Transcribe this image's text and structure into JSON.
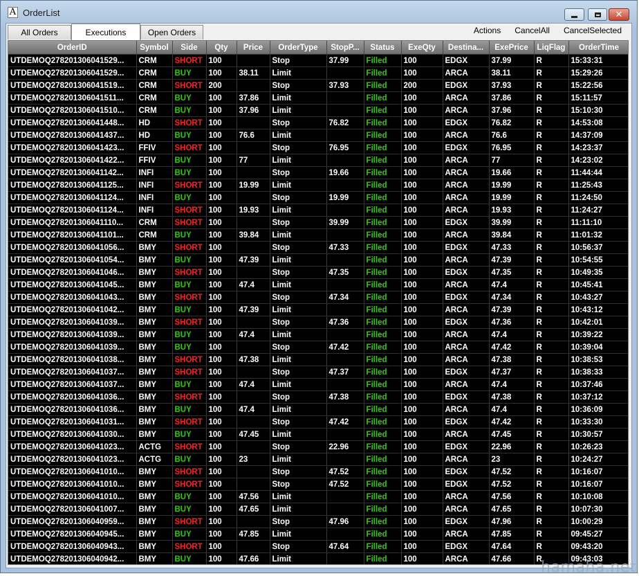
{
  "window": {
    "title": "OrderList"
  },
  "tabs": [
    "All Orders",
    "Executions",
    "Open Orders"
  ],
  "active_tab": "Executions",
  "menu": [
    "Actions",
    "CancelAll",
    "CancelSelected"
  ],
  "columns": [
    "OrderID",
    "Symbol",
    "Side",
    "Qty",
    "Price",
    "OrderType",
    "StopP...",
    "Status",
    "ExeQty",
    "Destina...",
    "ExePrice",
    "LiqFlag",
    "OrderTime"
  ],
  "rows": [
    [
      "UTDEMOQ278201306041529...",
      "CRM",
      "SHORT",
      "100",
      "",
      "Stop",
      "37.99",
      "Filled",
      "100",
      "EDGX",
      "37.99",
      "R",
      "15:33:31"
    ],
    [
      "UTDEMOQ278201306041529...",
      "CRM",
      "BUY",
      "100",
      "38.11",
      "Limit",
      "",
      "Filled",
      "100",
      "ARCA",
      "38.11",
      "R",
      "15:29:26"
    ],
    [
      "UTDEMOQ278201306041519...",
      "CRM",
      "SHORT",
      "200",
      "",
      "Stop",
      "37.93",
      "Filled",
      "200",
      "EDGX",
      "37.93",
      "R",
      "15:22:56"
    ],
    [
      "UTDEMOQ278201306041511...",
      "CRM",
      "BUY",
      "100",
      "37.86",
      "Limit",
      "",
      "Filled",
      "100",
      "ARCA",
      "37.86",
      "R",
      "15:11:57"
    ],
    [
      "UTDEMOQ278201306041510...",
      "CRM",
      "BUY",
      "100",
      "37.96",
      "Limit",
      "",
      "Filled",
      "100",
      "ARCA",
      "37.96",
      "R",
      "15:10:30"
    ],
    [
      "UTDEMOQ278201306041448...",
      "HD",
      "SHORT",
      "100",
      "",
      "Stop",
      "76.82",
      "Filled",
      "100",
      "EDGX",
      "76.82",
      "R",
      "14:53:08"
    ],
    [
      "UTDEMOQ278201306041437...",
      "HD",
      "BUY",
      "100",
      "76.6",
      "Limit",
      "",
      "Filled",
      "100",
      "ARCA",
      "76.6",
      "R",
      "14:37:09"
    ],
    [
      "UTDEMOQ278201306041423...",
      "FFIV",
      "SHORT",
      "100",
      "",
      "Stop",
      "76.95",
      "Filled",
      "100",
      "EDGX",
      "76.95",
      "R",
      "14:23:37"
    ],
    [
      "UTDEMOQ278201306041422...",
      "FFIV",
      "BUY",
      "100",
      "77",
      "Limit",
      "",
      "Filled",
      "100",
      "ARCA",
      "77",
      "R",
      "14:23:02"
    ],
    [
      "UTDEMOQ278201306041142...",
      "INFI",
      "BUY",
      "100",
      "",
      "Stop",
      "19.66",
      "Filled",
      "100",
      "ARCA",
      "19.66",
      "R",
      "11:44:44"
    ],
    [
      "UTDEMOQ278201306041125...",
      "INFI",
      "SHORT",
      "100",
      "19.99",
      "Limit",
      "",
      "Filled",
      "100",
      "ARCA",
      "19.99",
      "R",
      "11:25:43"
    ],
    [
      "UTDEMOQ278201306041124...",
      "INFI",
      "BUY",
      "100",
      "",
      "Stop",
      "19.99",
      "Filled",
      "100",
      "ARCA",
      "19.99",
      "R",
      "11:24:50"
    ],
    [
      "UTDEMOQ278201306041124...",
      "INFI",
      "SHORT",
      "100",
      "19.93",
      "Limit",
      "",
      "Filled",
      "100",
      "ARCA",
      "19.93",
      "R",
      "11:24:27"
    ],
    [
      "UTDEMOQ278201306041110...",
      "CRM",
      "SHORT",
      "100",
      "",
      "Stop",
      "39.99",
      "Filled",
      "100",
      "EDGX",
      "39.99",
      "R",
      "11:11:10"
    ],
    [
      "UTDEMOQ278201306041101...",
      "CRM",
      "BUY",
      "100",
      "39.84",
      "Limit",
      "",
      "Filled",
      "100",
      "ARCA",
      "39.84",
      "R",
      "11:01:32"
    ],
    [
      "UTDEMOQ278201306041056...",
      "BMY",
      "SHORT",
      "100",
      "",
      "Stop",
      "47.33",
      "Filled",
      "100",
      "EDGX",
      "47.33",
      "R",
      "10:56:37"
    ],
    [
      "UTDEMOQ278201306041054...",
      "BMY",
      "BUY",
      "100",
      "47.39",
      "Limit",
      "",
      "Filled",
      "100",
      "ARCA",
      "47.39",
      "R",
      "10:54:55"
    ],
    [
      "UTDEMOQ278201306041046...",
      "BMY",
      "SHORT",
      "100",
      "",
      "Stop",
      "47.35",
      "Filled",
      "100",
      "EDGX",
      "47.35",
      "R",
      "10:49:35"
    ],
    [
      "UTDEMOQ278201306041045...",
      "BMY",
      "BUY",
      "100",
      "47.4",
      "Limit",
      "",
      "Filled",
      "100",
      "ARCA",
      "47.4",
      "R",
      "10:45:41"
    ],
    [
      "UTDEMOQ278201306041043...",
      "BMY",
      "SHORT",
      "100",
      "",
      "Stop",
      "47.34",
      "Filled",
      "100",
      "EDGX",
      "47.34",
      "R",
      "10:43:27"
    ],
    [
      "UTDEMOQ278201306041042...",
      "BMY",
      "BUY",
      "100",
      "47.39",
      "Limit",
      "",
      "Filled",
      "100",
      "ARCA",
      "47.39",
      "R",
      "10:43:12"
    ],
    [
      "UTDEMOQ278201306041039...",
      "BMY",
      "SHORT",
      "100",
      "",
      "Stop",
      "47.36",
      "Filled",
      "100",
      "EDGX",
      "47.36",
      "R",
      "10:42:01"
    ],
    [
      "UTDEMOQ278201306041039...",
      "BMY",
      "BUY",
      "100",
      "47.4",
      "Limit",
      "",
      "Filled",
      "100",
      "ARCA",
      "47.4",
      "R",
      "10:39:22"
    ],
    [
      "UTDEMOQ278201306041039...",
      "BMY",
      "BUY",
      "100",
      "",
      "Stop",
      "47.42",
      "Filled",
      "100",
      "ARCA",
      "47.42",
      "R",
      "10:39:04"
    ],
    [
      "UTDEMOQ278201306041038...",
      "BMY",
      "SHORT",
      "100",
      "47.38",
      "Limit",
      "",
      "Filled",
      "100",
      "ARCA",
      "47.38",
      "R",
      "10:38:53"
    ],
    [
      "UTDEMOQ278201306041037...",
      "BMY",
      "SHORT",
      "100",
      "",
      "Stop",
      "47.37",
      "Filled",
      "100",
      "EDGX",
      "47.37",
      "R",
      "10:38:33"
    ],
    [
      "UTDEMOQ278201306041037...",
      "BMY",
      "BUY",
      "100",
      "47.4",
      "Limit",
      "",
      "Filled",
      "100",
      "ARCA",
      "47.4",
      "R",
      "10:37:46"
    ],
    [
      "UTDEMOQ278201306041036...",
      "BMY",
      "SHORT",
      "100",
      "",
      "Stop",
      "47.38",
      "Filled",
      "100",
      "EDGX",
      "47.38",
      "R",
      "10:37:12"
    ],
    [
      "UTDEMOQ278201306041036...",
      "BMY",
      "BUY",
      "100",
      "47.4",
      "Limit",
      "",
      "Filled",
      "100",
      "ARCA",
      "47.4",
      "R",
      "10:36:09"
    ],
    [
      "UTDEMOQ278201306041031...",
      "BMY",
      "SHORT",
      "100",
      "",
      "Stop",
      "47.42",
      "Filled",
      "100",
      "EDGX",
      "47.42",
      "R",
      "10:33:30"
    ],
    [
      "UTDEMOQ278201306041030...",
      "BMY",
      "BUY",
      "100",
      "47.45",
      "Limit",
      "",
      "Filled",
      "100",
      "ARCA",
      "47.45",
      "R",
      "10:30:57"
    ],
    [
      "UTDEMOQ278201306041023...",
      "ACTG",
      "SHORT",
      "100",
      "",
      "Stop",
      "22.96",
      "Filled",
      "100",
      "EDGX",
      "22.96",
      "R",
      "10:26:23"
    ],
    [
      "UTDEMOQ278201306041023...",
      "ACTG",
      "BUY",
      "100",
      "23",
      "Limit",
      "",
      "Filled",
      "100",
      "ARCA",
      "23",
      "R",
      "10:24:27"
    ],
    [
      "UTDEMOQ278201306041010...",
      "BMY",
      "SHORT",
      "100",
      "",
      "Stop",
      "47.52",
      "Filled",
      "100",
      "EDGX",
      "47.52",
      "R",
      "10:16:07"
    ],
    [
      "UTDEMOQ278201306041010...",
      "BMY",
      "SHORT",
      "100",
      "",
      "Stop",
      "47.52",
      "Filled",
      "100",
      "EDGX",
      "47.52",
      "R",
      "10:16:07"
    ],
    [
      "UTDEMOQ278201306041010...",
      "BMY",
      "BUY",
      "100",
      "47.56",
      "Limit",
      "",
      "Filled",
      "100",
      "ARCA",
      "47.56",
      "R",
      "10:10:08"
    ],
    [
      "UTDEMOQ278201306041007...",
      "BMY",
      "BUY",
      "100",
      "47.65",
      "Limit",
      "",
      "Filled",
      "100",
      "ARCA",
      "47.65",
      "R",
      "10:07:30"
    ],
    [
      "UTDEMOQ278201306040959...",
      "BMY",
      "SHORT",
      "100",
      "",
      "Stop",
      "47.96",
      "Filled",
      "100",
      "EDGX",
      "47.96",
      "R",
      "10:00:29"
    ],
    [
      "UTDEMOQ278201306040945...",
      "BMY",
      "BUY",
      "100",
      "47.85",
      "Limit",
      "",
      "Filled",
      "100",
      "ARCA",
      "47.85",
      "R",
      "09:45:27"
    ],
    [
      "UTDEMOQ278201306040943...",
      "BMY",
      "SHORT",
      "100",
      "",
      "Stop",
      "47.64",
      "Filled",
      "100",
      "EDGX",
      "47.64",
      "R",
      "09:43:20"
    ],
    [
      "UTDEMOQ278201306040942...",
      "BMY",
      "BUY",
      "100",
      "47.66",
      "Limit",
      "",
      "Filled",
      "100",
      "ARCA",
      "47.66",
      "R",
      "09:43:03"
    ]
  ],
  "colors": {
    "short": "#ff2020",
    "buy": "#33cc00",
    "filled": "#33cc00",
    "grid_bg": "#000000"
  },
  "watermark": "hamaha.net"
}
